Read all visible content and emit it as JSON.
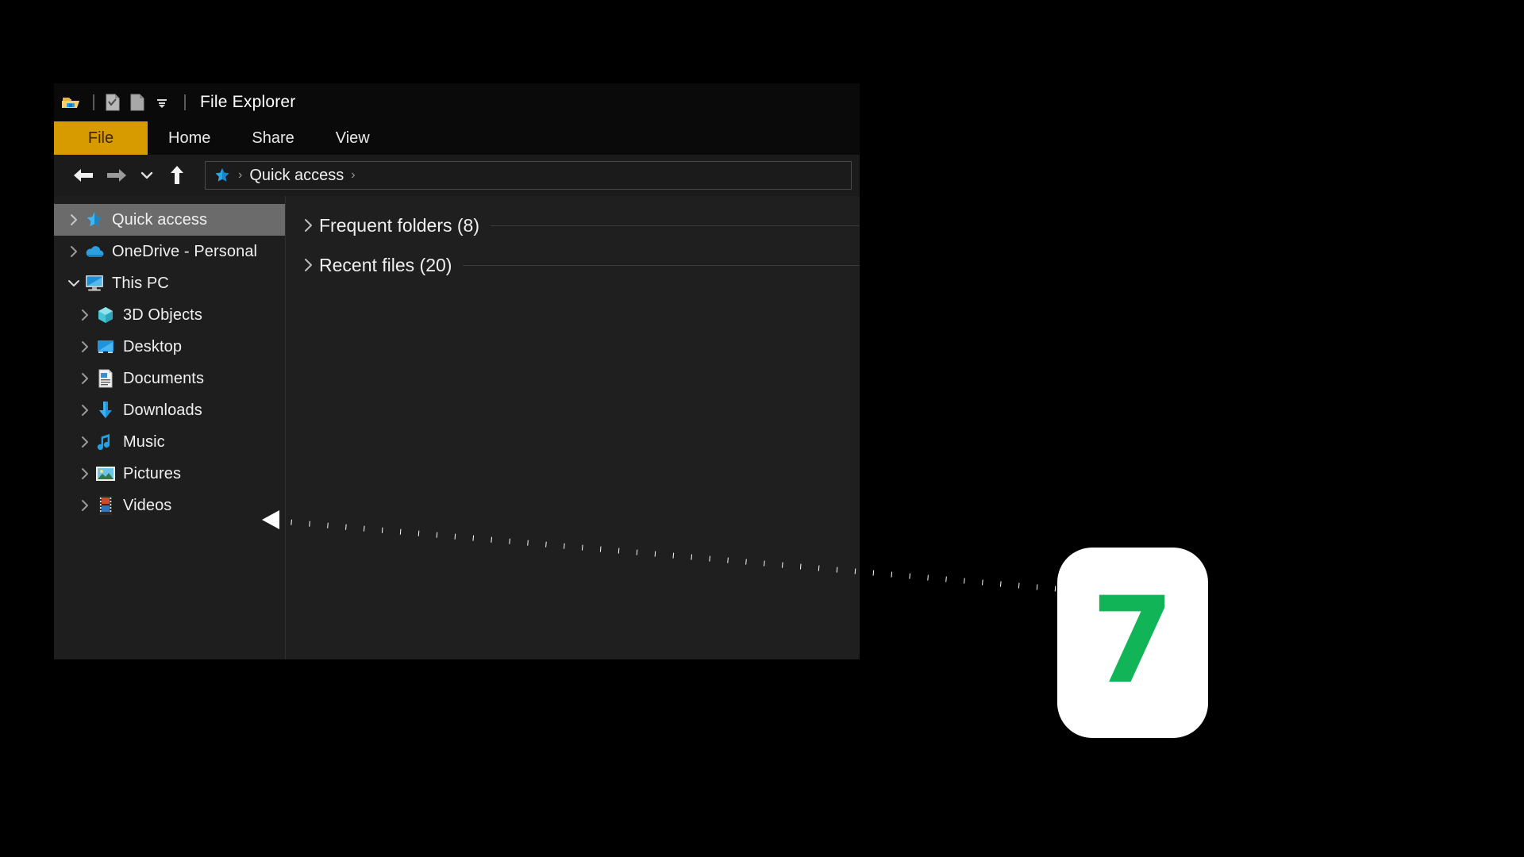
{
  "window": {
    "title": "File Explorer",
    "quick_access_toolbar": [
      {
        "name": "folder-icon",
        "label": "File Explorer icon"
      },
      {
        "name": "properties-icon",
        "label": "Properties"
      },
      {
        "name": "new-folder-icon",
        "label": "New folder"
      },
      {
        "name": "chevron-down-icon",
        "label": "Customize Quick Access Toolbar"
      }
    ],
    "ribbon_tabs": [
      {
        "label": "File",
        "active": true
      },
      {
        "label": "Home",
        "active": false
      },
      {
        "label": "Share",
        "active": false
      },
      {
        "label": "View",
        "active": false
      }
    ],
    "navigation": {
      "back_label": "Back",
      "forward_label": "Forward",
      "recent_label": "Recent locations",
      "up_label": "Up one level",
      "breadcrumb": [
        {
          "icon": "quick-access-star-icon",
          "label": "Quick access"
        }
      ],
      "breadcrumb_separator": "›",
      "trailing_separator": "›"
    }
  },
  "sidebar": {
    "items": [
      {
        "label": "Quick access",
        "icon": "star-icon",
        "indent": 0,
        "expanded": false,
        "selected": true
      },
      {
        "label": "OneDrive - Personal",
        "icon": "onedrive-cloud-icon",
        "indent": 0,
        "expanded": false,
        "selected": false
      },
      {
        "label": "This PC",
        "icon": "this-pc-monitor-icon",
        "indent": 0,
        "expanded": true,
        "selected": false
      },
      {
        "label": "3D Objects",
        "icon": "3d-objects-cube-icon",
        "indent": 1,
        "expanded": false,
        "selected": false
      },
      {
        "label": "Desktop",
        "icon": "desktop-icon",
        "indent": 1,
        "expanded": false,
        "selected": false
      },
      {
        "label": "Documents",
        "icon": "documents-icon",
        "indent": 1,
        "expanded": false,
        "selected": false
      },
      {
        "label": "Downloads",
        "icon": "downloads-arrow-icon",
        "indent": 1,
        "expanded": false,
        "selected": false
      },
      {
        "label": "Music",
        "icon": "music-note-icon",
        "indent": 1,
        "expanded": false,
        "selected": false
      },
      {
        "label": "Pictures",
        "icon": "pictures-icon",
        "indent": 1,
        "expanded": false,
        "selected": false
      },
      {
        "label": "Videos",
        "icon": "videos-filmstrip-icon",
        "indent": 1,
        "expanded": false,
        "selected": false
      }
    ]
  },
  "main": {
    "groups": [
      {
        "label": "Frequent folders (8)",
        "expanded": false
      },
      {
        "label": "Recent files (20)",
        "expanded": false
      }
    ]
  },
  "callout": {
    "number": "7",
    "target": "Downloads",
    "accent_color": "#12b458",
    "badge_color": "#ffffff",
    "line_style": "dotted"
  },
  "colors": {
    "file_tab": "#d79b00",
    "selection": "#6b6b6b",
    "window_bg": "#1f1f1f",
    "titlebar_bg": "#0a0a0a",
    "desktop_bg": "#000000"
  }
}
